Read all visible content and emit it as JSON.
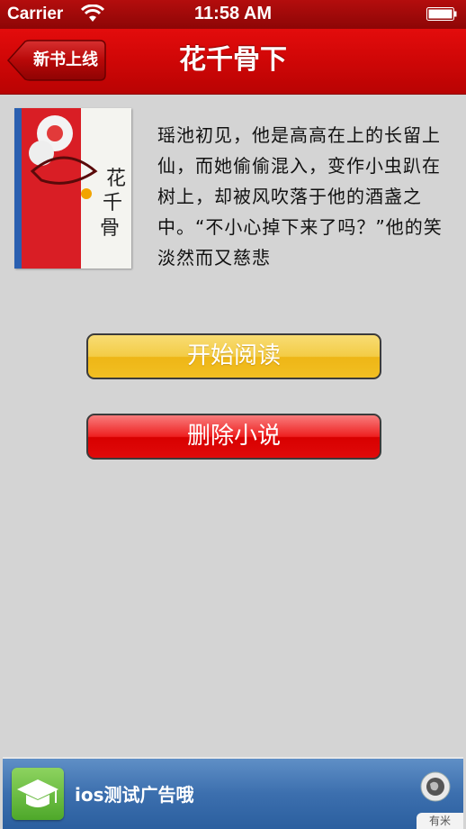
{
  "status": {
    "carrier": "Carrier",
    "time": "11:58 AM"
  },
  "nav": {
    "back_label": "新书上线",
    "title": "花千骨下"
  },
  "book": {
    "cover_title": "花千骨",
    "description": "瑶池初见，他是高高在上的长留上仙，而她偷偷混入，变作小虫趴在树上，却被风吹落于他的酒盏之中。“不小心掉下来了吗？”他的笑淡然而又慈悲"
  },
  "actions": {
    "read_label": "开始阅读",
    "delete_label": "删除小说"
  },
  "ad": {
    "text": "ios测试广告哦",
    "badge": "有米"
  },
  "colors": {
    "nav_red": "#d10707",
    "read_yellow": "#f2bf22",
    "delete_red": "#e00a0a",
    "ad_blue": "#3c6fae"
  }
}
